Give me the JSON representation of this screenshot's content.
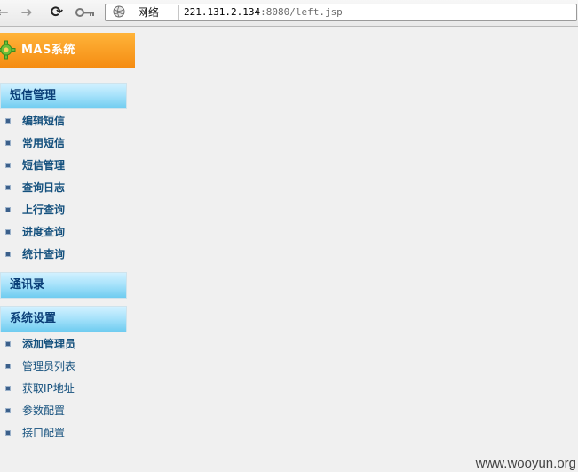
{
  "toolbar": {
    "back_icon": "back-arrow-icon",
    "forward_icon": "forward-arrow-icon",
    "reload_icon": "reload-icon",
    "key_icon": "key-icon",
    "address": {
      "zone_label": "网络",
      "url_host": "221.131.2.134",
      "url_path": ":8080/left.jsp"
    }
  },
  "brand": {
    "title": "MAS系统"
  },
  "sections": [
    {
      "title": "短信管理",
      "items": [
        "编辑短信",
        "常用短信",
        "短信管理",
        "查询日志",
        "上行查询",
        "进度查询",
        "统计查询"
      ]
    },
    {
      "title": "通讯录",
      "items": []
    },
    {
      "title": "系统设置",
      "items": [
        "添加管理员",
        "管理员列表",
        "获取IP地址",
        "参数配置",
        "接口配置"
      ]
    }
  ],
  "colors": {
    "brand_orange": "#f7941d",
    "section_blue": "#a9e3fb",
    "link_text": "#14507d"
  },
  "watermark": "www.wooyun.org"
}
